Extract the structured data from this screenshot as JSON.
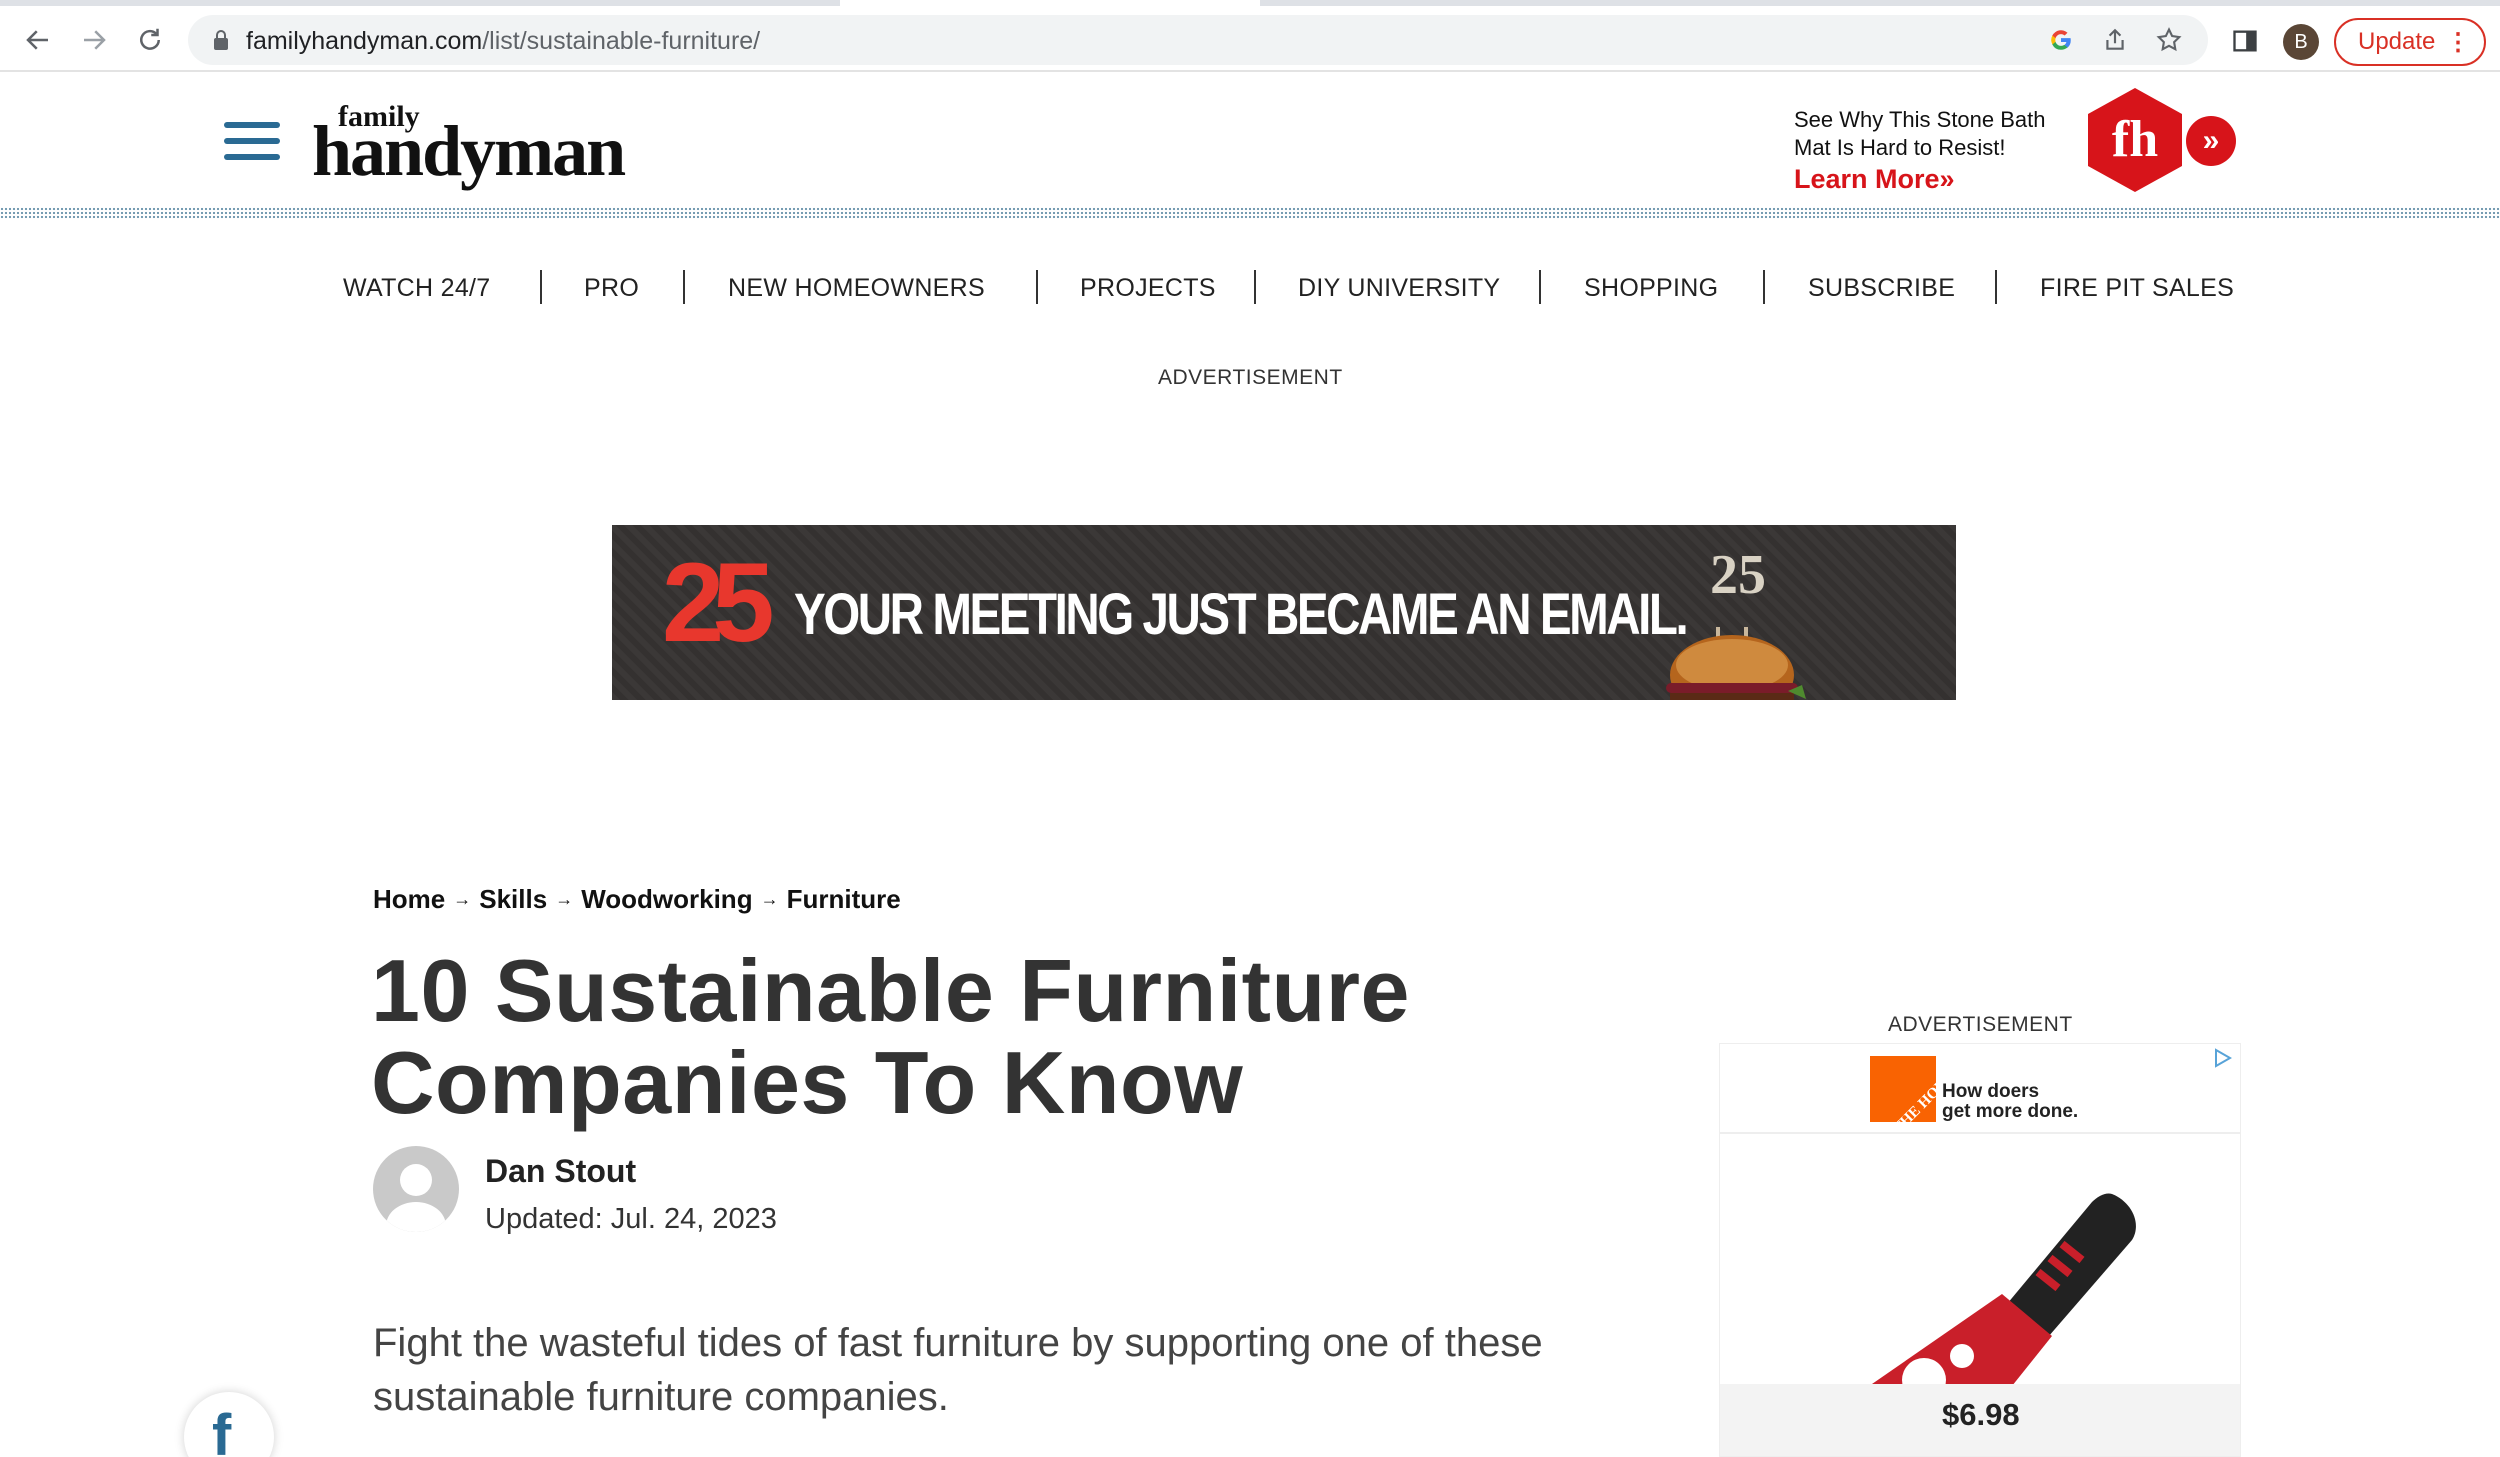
{
  "browser": {
    "url_domain": "familyhandyman.com",
    "url_path": "/list/sustainable-furniture/",
    "profile_initial": "B",
    "update_label": "Update"
  },
  "header": {
    "logo_top": "family",
    "logo_main": "handyman",
    "promo_line1": "See Why This Stone Bath",
    "promo_line2": "Mat Is Hard to Resist!",
    "promo_cta": "Learn More»",
    "badge_text": "fh"
  },
  "nav": {
    "items": [
      "WATCH 24/7",
      "PRO",
      "NEW HOMEOWNERS",
      "PROJECTS",
      "DIY UNIVERSITY",
      "SHOPPING",
      "SUBSCRIBE",
      "FIRE PIT SALES"
    ]
  },
  "ads": {
    "top_label": "ADVERTISEMENT",
    "side_label": "ADVERTISEMENT",
    "banner_logo": "25",
    "banner_headline": "YOUR MEETING JUST BECAME AN EMAIL.",
    "banner_candle": "25",
    "side_brand": "THE HOME DEPOT",
    "side_tagline_1": "How doers",
    "side_tagline_2": "get more done.",
    "side_price": "$6.98"
  },
  "article": {
    "breadcrumb": [
      "Home",
      "Skills",
      "Woodworking",
      "Furniture"
    ],
    "breadcrumb_sep": "→",
    "title": "10 Sustainable Furniture Companies To Know",
    "author": "Dan Stout",
    "updated": "Updated: Jul. 24, 2023",
    "dek": "Fight the wasteful tides of fast furniture by supporting one of these sustainable furniture companies."
  },
  "share": {
    "facebook_glyph": "f"
  },
  "colors": {
    "brand_blue": "#2a6a93",
    "brand_red": "#d7141a",
    "update_red": "#d93025",
    "home_depot_orange": "#f96302"
  }
}
